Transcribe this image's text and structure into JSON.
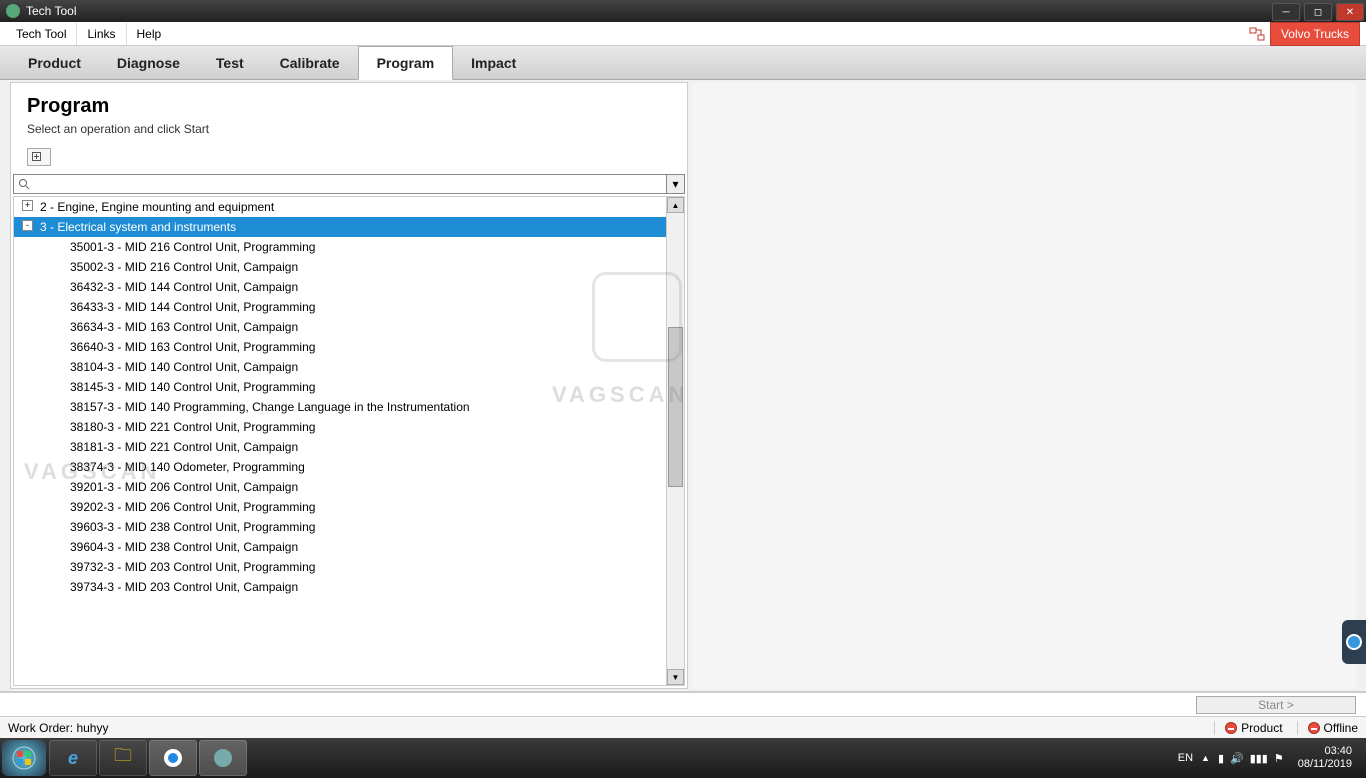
{
  "titlebar": {
    "title": "Tech Tool"
  },
  "menubar": {
    "items": [
      "Tech Tool",
      "Links",
      "Help"
    ],
    "brand": "Volvo Trucks"
  },
  "tabs": {
    "items": [
      "Product",
      "Diagnose",
      "Test",
      "Calibrate",
      "Program",
      "Impact"
    ],
    "active_index": 4
  },
  "panel": {
    "title": "Program",
    "subtitle": "Select an operation and click Start"
  },
  "search": {
    "value": ""
  },
  "tree": {
    "nodes": [
      {
        "level": 0,
        "expander": "+",
        "label": "2 - Engine, Engine mounting and equipment",
        "selected": false
      },
      {
        "level": 0,
        "expander": "-",
        "label": "3 - Electrical system and instruments",
        "selected": true
      },
      {
        "level": 1,
        "label": "35001-3 - MID 216 Control Unit, Programming"
      },
      {
        "level": 1,
        "label": "35002-3 - MID 216 Control Unit, Campaign"
      },
      {
        "level": 1,
        "label": "36432-3 - MID 144 Control Unit, Campaign"
      },
      {
        "level": 1,
        "label": "36433-3 - MID 144 Control Unit, Programming"
      },
      {
        "level": 1,
        "label": "36634-3 - MID 163 Control Unit, Campaign"
      },
      {
        "level": 1,
        "label": "36640-3 - MID 163 Control Unit, Programming"
      },
      {
        "level": 1,
        "label": "38104-3 - MID 140 Control Unit, Campaign"
      },
      {
        "level": 1,
        "label": "38145-3 - MID 140 Control Unit, Programming"
      },
      {
        "level": 1,
        "label": "38157-3 - MID 140 Programming, Change Language in the Instrumentation"
      },
      {
        "level": 1,
        "label": "38180-3 - MID 221 Control Unit, Programming"
      },
      {
        "level": 1,
        "label": "38181-3 - MID 221 Control Unit, Campaign"
      },
      {
        "level": 1,
        "label": "38374-3 - MID 140 Odometer, Programming"
      },
      {
        "level": 1,
        "label": "39201-3 - MID 206 Control Unit, Campaign"
      },
      {
        "level": 1,
        "label": "39202-3 - MID 206 Control Unit, Programming"
      },
      {
        "level": 1,
        "label": "39603-3 - MID 238 Control Unit, Programming"
      },
      {
        "level": 1,
        "label": "39604-3 - MID 238 Control Unit, Campaign"
      },
      {
        "level": 1,
        "label": "39732-3 - MID 203 Control Unit, Programming"
      },
      {
        "level": 1,
        "label": "39734-3 - MID 203 Control Unit, Campaign"
      }
    ]
  },
  "footer": {
    "start": "Start >"
  },
  "status": {
    "work_order": "Work Order: huhyy",
    "product": "Product",
    "offline": "Offline"
  },
  "tray": {
    "lang": "EN",
    "time": "03:40",
    "date": "08/11/2019"
  },
  "watermark": "VAGSCAN"
}
